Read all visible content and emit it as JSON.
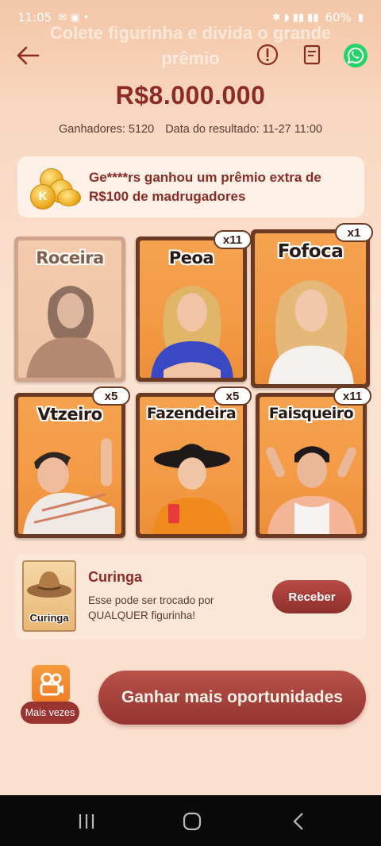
{
  "status_bar": {
    "time": "11:05",
    "battery": "60%"
  },
  "header": {
    "ghost_title_line1": "Colete figurinha e divida o grande",
    "ghost_title_line2": "prêmio"
  },
  "prize": {
    "amount": "R$8.000.000"
  },
  "meta": {
    "winners": "Ganhadores: 5120",
    "result_date": "Data do resultado: 11-27 11:00"
  },
  "banner": {
    "text": "Ge****rs ganhou um prêmio extra de R$100 de madrugadores"
  },
  "cards": [
    {
      "name": "Roceira",
      "count": "",
      "dim": true
    },
    {
      "name": "Peoa",
      "count": "x11"
    },
    {
      "name": "Fofoca",
      "count": "x1"
    },
    {
      "name": "Vtzeiro",
      "count": "x5"
    },
    {
      "name": "Fazendeira",
      "count": "x5"
    },
    {
      "name": "Faisqueiro",
      "count": "x11"
    }
  ],
  "curinga": {
    "card_label": "Curinga",
    "title": "Curinga",
    "description": "Esse pode ser trocado por QUALQUER figurinha!",
    "button": "Receber"
  },
  "footer": {
    "more_label": "Mais vezes",
    "main_button": "Ganhar mais oportunidades"
  },
  "colors": {
    "brand": "#8c2b26",
    "card_orange": "#f39a45",
    "button": "#943430"
  }
}
